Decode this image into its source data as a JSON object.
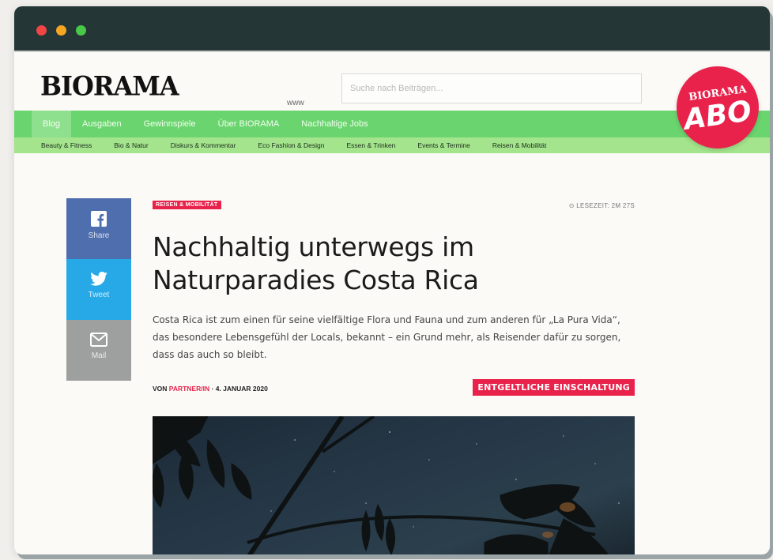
{
  "window": {
    "controls": [
      "close",
      "minimize",
      "maximize"
    ]
  },
  "header": {
    "logo": "BIORAMA",
    "www": "www",
    "search_placeholder": "Suche nach Beiträgen...",
    "abo_badge": {
      "line1": "BIORAMA",
      "line2": "ABO"
    }
  },
  "nav_main": {
    "items": [
      "Blog",
      "Ausgaben",
      "Gewinnspiele",
      "Über BIORAMA",
      "Nachhaltige Jobs"
    ],
    "active_index": 0
  },
  "nav_sub": {
    "items": [
      "Beauty & Fitness",
      "Bio & Natur",
      "Diskurs & Kommentar",
      "Eco Fashion & Design",
      "Essen & Trinken",
      "Events & Termine",
      "Reisen & Mobilität"
    ]
  },
  "share": {
    "facebook": "Share",
    "twitter": "Tweet",
    "mail": "Mail"
  },
  "article": {
    "category": "REISEN & MOBILITÄT",
    "reading_time": "⊙ LESEZEIT: 2M 27S",
    "headline": "Nachhaltig unterwegs im Naturparadies Costa Rica",
    "lead": "Costa Rica ist zum einen für seine vielfältige Flora und Fauna und zum anderen für „La Pura Vida“, das besondere Lebensgefühl der Locals, bekannt – ein Grund mehr, als Reisender dafür zu sorgen, dass das auch so bleibt.",
    "byline_prefix": "VON",
    "author": "PARTNER/IN",
    "date": "· 4. JANUAR 2020",
    "sponsored": "ENTGELTLICHE EINSCHALTUNG"
  },
  "colors": {
    "titlebar": "#243636",
    "nav_main": "#6ad46e",
    "nav_sub": "#a3e48c",
    "accent": "#e8224a",
    "facebook": "#4f6eae",
    "twitter": "#27a9e8",
    "mail": "#9ea09f"
  }
}
